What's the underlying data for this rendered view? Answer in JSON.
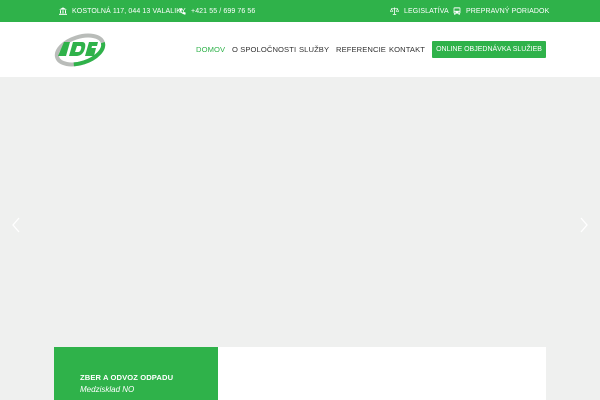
{
  "topbar": {
    "address": "KOSTOLNÁ 117, 044 13 VALALIKY",
    "address_icon": "bank-icon",
    "phone": "+421 55 / 699 76 56",
    "phone_icon": "phone-icon",
    "legislation": "LEGISLATÍVA",
    "legislation_icon": "scales-icon",
    "transport": "PREPRAVNÝ PORIADOK",
    "transport_icon": "bus-icon"
  },
  "header": {
    "logo_icon": "company-logo",
    "nav": {
      "home": "DOMOV",
      "about": "O SPOLOČNOSTI",
      "services": "SLUŽBY",
      "references": "REFERENCIE",
      "contact": "KONTAKT"
    },
    "cta": "ONLINE OBJEDNÁVKA SLUŽIEB"
  },
  "hero": {
    "prev_icon": "chevron-left-icon",
    "next_icon": "chevron-right-icon"
  },
  "card": {
    "title": "ZBER A ODVOZ ODPADU",
    "subtitle": "Medzisklad NO"
  },
  "colors": {
    "brand_green": "#2fb24a",
    "hero_background": "#eff0ef"
  }
}
